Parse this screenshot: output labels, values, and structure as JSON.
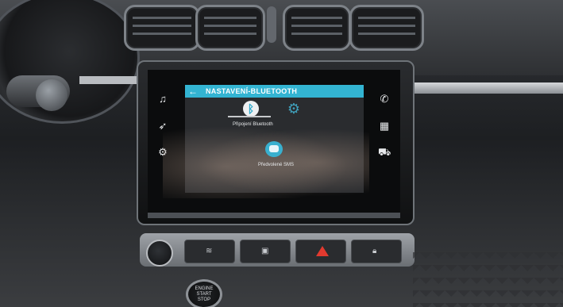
{
  "screen": {
    "header": {
      "back_icon": "←",
      "title": "NASTAVENÍ-BLUETOOTH"
    },
    "tiles": [
      {
        "label": "Připojení Bluetooth",
        "icon": "bluetooth-icon"
      },
      {
        "label": "",
        "icon": "gear-icon"
      },
      {
        "label": "Předvolené SMS",
        "icon": "sms-icon"
      }
    ],
    "left_rail_icons": [
      "music-icon",
      "navigation-icon",
      "apps-icon"
    ],
    "right_rail_icons": [
      "phone-icon",
      "grid-icon",
      "car-icon"
    ]
  },
  "controls": {
    "start_button": {
      "line1": "ENGINE",
      "line2": "START",
      "line3": "STOP"
    }
  },
  "colors": {
    "accent": "#33b4d2",
    "hazard": "#e23a2f"
  }
}
